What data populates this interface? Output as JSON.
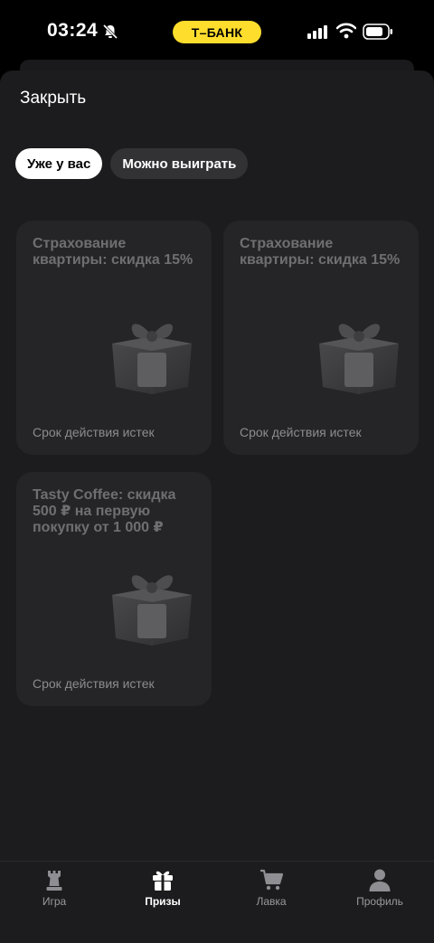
{
  "status_bar": {
    "time": "03:24",
    "brand": "Т–БАНК",
    "icons": [
      "bell-slash-icon",
      "signal-icon",
      "wifi-icon",
      "battery-icon"
    ]
  },
  "header": {
    "close_label": "Закрыть"
  },
  "tabs": [
    {
      "label": "Уже у вас",
      "active": true
    },
    {
      "label": "Можно выиграть",
      "active": false
    }
  ],
  "prizes": [
    {
      "title": "Страхование квартиры: скидка 15%",
      "status": "Срок действия истек",
      "icon": "gift-icon"
    },
    {
      "title": "Страхование квартиры: скидка 15%",
      "status": "Срок действия истек",
      "icon": "gift-icon"
    },
    {
      "title": "Tasty Coffee: скидка 500 ₽ на первую покупку от 1 000 ₽",
      "status": "Срок действия истек",
      "icon": "gift-icon"
    }
  ],
  "tabbar": [
    {
      "label": "Игра",
      "icon": "chess-rook-icon",
      "active": false
    },
    {
      "label": "Призы",
      "icon": "gift-icon",
      "active": true
    },
    {
      "label": "Лавка",
      "icon": "cart-icon",
      "active": false
    },
    {
      "label": "Профиль",
      "icon": "person-icon",
      "active": false
    }
  ],
  "colors": {
    "brand_yellow": "#ffdd2d",
    "background": "#1c1c1e",
    "card": "#252527"
  }
}
